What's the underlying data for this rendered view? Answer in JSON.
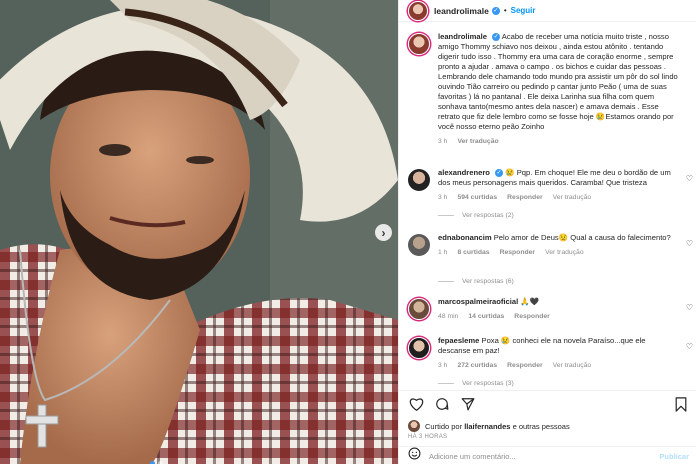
{
  "header": {
    "username": "leandrolimale",
    "separator": "•",
    "follow_label": "Seguir"
  },
  "caption": {
    "username": "leandrolimale",
    "text": "Acabo de receber uma notícia muito triste , nosso amigo Thommy schiavo nos deixou , ainda estou atônito . tentando digerir tudo isso . Thommy era uma cara de coração enorme , sempre pronto a ajudar . amava o campo . os bichos e cuidar das pessoas . Lembrando dele chamando todo mundo pra assistir um pôr do sol lindo ouvindo Tião carreiro ou pedindo p cantar junto Peão ( uma de suas favoritas ) lá no pantanal . Ele deixa Larinha sua filha com quem sonhava tanto(mesmo antes dela nascer) e amava demais . Esse retrato que fiz dele lembro como se fosse hoje 😢Estamos orando por você nosso eterno peão Zoinho",
    "time": "3 h",
    "translate": "Ver tradução"
  },
  "comments": [
    {
      "username": "alexandrenero",
      "text": "😢 Pqp. Em choque! Ele me deu o bordão de um dos meus personagens mais queridos. Caramba! Que tristeza",
      "time": "3 h",
      "likes": "594 curtidas",
      "reply": "Responder",
      "translate": "Ver tradução",
      "replies": "Ver respostas (2)"
    },
    {
      "username": "ednabonancim",
      "text": "Pelo amor de Deus😟 Qual a causa do falecimento?",
      "time": "1 h",
      "likes": "8 curtidas",
      "reply": "Responder",
      "translate": "Ver tradução",
      "replies": "Ver respostas (6)"
    },
    {
      "username": "marcospalmeiraoficial",
      "text": "🙏🖤",
      "time": "48 min",
      "likes": "14 curtidas",
      "reply": "Responder"
    },
    {
      "username": "fepaesleme",
      "text": "Poxa 😢 conheci ele na novela Paraíso...que ele descanse em paz!",
      "time": "3 h",
      "likes": "272 curtidas",
      "reply": "Responder",
      "translate": "Ver tradução",
      "replies": "Ver respostas (3)"
    }
  ],
  "footer": {
    "liked_prefix": "Curtido por",
    "liked_user": "llaifernandes",
    "liked_suffix": "e outras pessoas",
    "timestamp": "HÁ 3 HORAS",
    "comment_placeholder": "Adicione um comentário...",
    "publish_label": "Publicar"
  },
  "icons": {
    "heart": "heart-icon",
    "comment": "comment-icon",
    "share": "share-icon",
    "bookmark": "bookmark-icon",
    "emoji": "emoji-icon",
    "carousel_next": "chevron-right-icon"
  },
  "colors": {
    "accent": "#0095f6",
    "verified": "#3897f0",
    "muted": "#8e8e8e"
  }
}
